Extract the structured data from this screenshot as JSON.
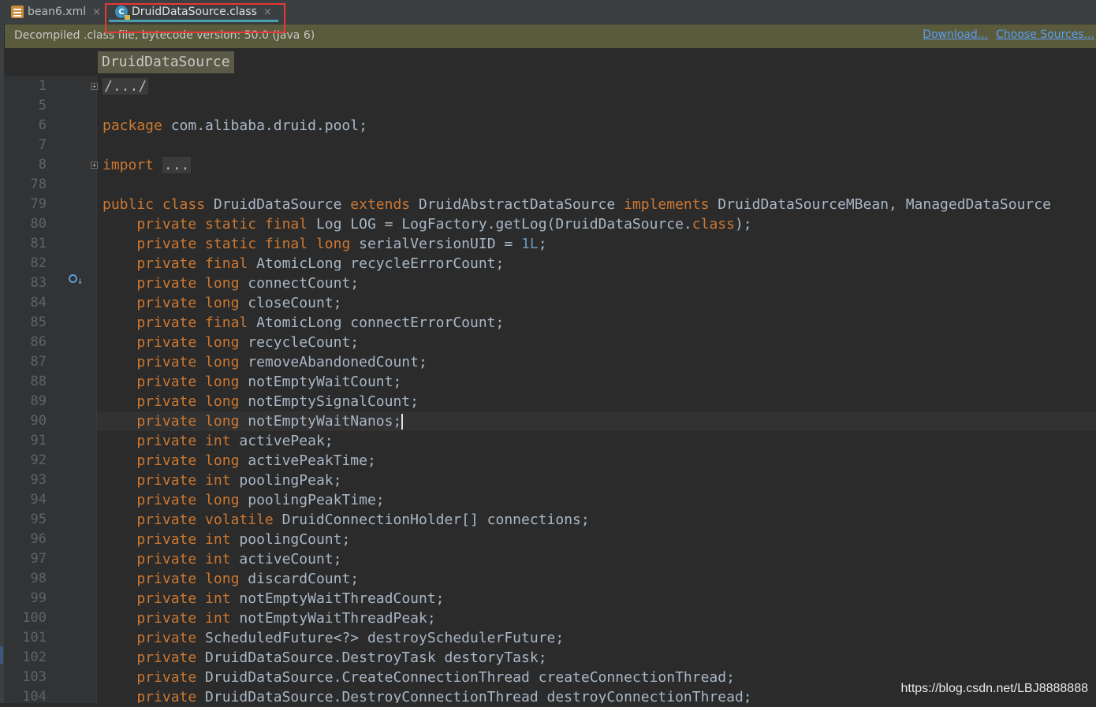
{
  "tabs": [
    {
      "label": "bean6.xml",
      "icon": "xml-file-icon",
      "close": "×"
    },
    {
      "label": "DruidDataSource.class",
      "icon": "class-file-icon",
      "close": "×"
    }
  ],
  "banner": {
    "message": "Decompiled .class file, bytecode version: 50.0 (Java 6)",
    "download_label": "Download...",
    "choose_sources_label": "Choose Sources..."
  },
  "breadcrumb": "DruidDataSource",
  "colors": {
    "keyword": "#cc7832",
    "number": "#6897bb",
    "text": "#a9b7c6",
    "link": "#589df6"
  },
  "code": [
    {
      "n": "1",
      "segs": [
        [
          "fold",
          "/.../"
        ]
      ],
      "fold": true
    },
    {
      "n": "5",
      "segs": []
    },
    {
      "n": "6",
      "segs": [
        [
          "kw",
          "package"
        ],
        [
          "t",
          " com.alibaba.druid.pool;"
        ]
      ]
    },
    {
      "n": "7",
      "segs": []
    },
    {
      "n": "8",
      "segs": [
        [
          "kw",
          "import"
        ],
        [
          "t",
          " "
        ],
        [
          "fold",
          "..."
        ]
      ],
      "fold": true
    },
    {
      "n": "78",
      "segs": []
    },
    {
      "n": "79",
      "segs": [
        [
          "kw",
          "public class"
        ],
        [
          "t",
          " DruidDataSource "
        ],
        [
          "kw",
          "extends"
        ],
        [
          "t",
          " DruidAbstractDataSource "
        ],
        [
          "kw",
          "implements"
        ],
        [
          "t",
          " DruidDataSourceMBean, ManagedDataSource"
        ]
      ]
    },
    {
      "n": "80",
      "segs": [
        [
          "t",
          "    "
        ],
        [
          "kw",
          "private static final"
        ],
        [
          "t",
          " Log LOG = LogFactory.getLog(DruidDataSource."
        ],
        [
          "kw",
          "class"
        ],
        [
          "t",
          ");"
        ]
      ]
    },
    {
      "n": "81",
      "segs": [
        [
          "t",
          "    "
        ],
        [
          "kw",
          "private static final long"
        ],
        [
          "t",
          " serialVersionUID = "
        ],
        [
          "num",
          "1L"
        ],
        [
          "t",
          ";"
        ]
      ]
    },
    {
      "n": "82",
      "segs": [
        [
          "t",
          "    "
        ],
        [
          "kw",
          "private final"
        ],
        [
          "t",
          " AtomicLong recycleErrorCount;"
        ]
      ]
    },
    {
      "n": "83",
      "segs": [
        [
          "t",
          "    "
        ],
        [
          "kw",
          "private long"
        ],
        [
          "t",
          " connectCount;"
        ]
      ]
    },
    {
      "n": "84",
      "segs": [
        [
          "t",
          "    "
        ],
        [
          "kw",
          "private long"
        ],
        [
          "t",
          " closeCount;"
        ]
      ]
    },
    {
      "n": "85",
      "segs": [
        [
          "t",
          "    "
        ],
        [
          "kw",
          "private final"
        ],
        [
          "t",
          " AtomicLong connectErrorCount;"
        ]
      ]
    },
    {
      "n": "86",
      "segs": [
        [
          "t",
          "    "
        ],
        [
          "kw",
          "private long"
        ],
        [
          "t",
          " recycleCount;"
        ]
      ]
    },
    {
      "n": "87",
      "segs": [
        [
          "t",
          "    "
        ],
        [
          "kw",
          "private long"
        ],
        [
          "t",
          " removeAbandonedCount;"
        ]
      ]
    },
    {
      "n": "88",
      "segs": [
        [
          "t",
          "    "
        ],
        [
          "kw",
          "private long"
        ],
        [
          "t",
          " notEmptyWaitCount;"
        ]
      ]
    },
    {
      "n": "89",
      "segs": [
        [
          "t",
          "    "
        ],
        [
          "kw",
          "private long"
        ],
        [
          "t",
          " notEmptySignalCount;"
        ]
      ]
    },
    {
      "n": "90",
      "segs": [
        [
          "t",
          "    "
        ],
        [
          "kw",
          "private long"
        ],
        [
          "t",
          " notEmptyWaitNanos;"
        ],
        [
          "caret",
          ""
        ]
      ],
      "current": true
    },
    {
      "n": "91",
      "segs": [
        [
          "t",
          "    "
        ],
        [
          "kw",
          "private int"
        ],
        [
          "t",
          " activePeak;"
        ]
      ]
    },
    {
      "n": "92",
      "segs": [
        [
          "t",
          "    "
        ],
        [
          "kw",
          "private long"
        ],
        [
          "t",
          " activePeakTime;"
        ]
      ]
    },
    {
      "n": "93",
      "segs": [
        [
          "t",
          "    "
        ],
        [
          "kw",
          "private int"
        ],
        [
          "t",
          " poolingPeak;"
        ]
      ]
    },
    {
      "n": "94",
      "segs": [
        [
          "t",
          "    "
        ],
        [
          "kw",
          "private long"
        ],
        [
          "t",
          " poolingPeakTime;"
        ]
      ]
    },
    {
      "n": "95",
      "segs": [
        [
          "t",
          "    "
        ],
        [
          "kw",
          "private volatile"
        ],
        [
          "t",
          " DruidConnectionHolder[] connections;"
        ]
      ]
    },
    {
      "n": "96",
      "segs": [
        [
          "t",
          "    "
        ],
        [
          "kw",
          "private int"
        ],
        [
          "t",
          " poolingCount;"
        ]
      ]
    },
    {
      "n": "97",
      "segs": [
        [
          "t",
          "    "
        ],
        [
          "kw",
          "private int"
        ],
        [
          "t",
          " activeCount;"
        ]
      ]
    },
    {
      "n": "98",
      "segs": [
        [
          "t",
          "    "
        ],
        [
          "kw",
          "private long"
        ],
        [
          "t",
          " discardCount;"
        ]
      ]
    },
    {
      "n": "99",
      "segs": [
        [
          "t",
          "    "
        ],
        [
          "kw",
          "private int"
        ],
        [
          "t",
          " notEmptyWaitThreadCount;"
        ]
      ]
    },
    {
      "n": "100",
      "segs": [
        [
          "t",
          "    "
        ],
        [
          "kw",
          "private int"
        ],
        [
          "t",
          " notEmptyWaitThreadPeak;"
        ]
      ]
    },
    {
      "n": "101",
      "segs": [
        [
          "t",
          "    "
        ],
        [
          "kw",
          "private"
        ],
        [
          "t",
          " ScheduledFuture<?> destroySchedulerFuture;"
        ]
      ]
    },
    {
      "n": "102",
      "segs": [
        [
          "t",
          "    "
        ],
        [
          "kw",
          "private"
        ],
        [
          "t",
          " DruidDataSource.DestroyTask destoryTask;"
        ]
      ]
    },
    {
      "n": "103",
      "segs": [
        [
          "t",
          "    "
        ],
        [
          "kw",
          "private"
        ],
        [
          "t",
          " DruidDataSource.CreateConnectionThread createConnectionThread;"
        ]
      ]
    },
    {
      "n": "104",
      "segs": [
        [
          "t",
          "    "
        ],
        [
          "kw",
          "private"
        ],
        [
          "t",
          " DruidDataSource.DestroyConnectionThread destroyConnectionThread;"
        ]
      ]
    }
  ],
  "watermark": "https://blog.csdn.net/LBJ8888888"
}
